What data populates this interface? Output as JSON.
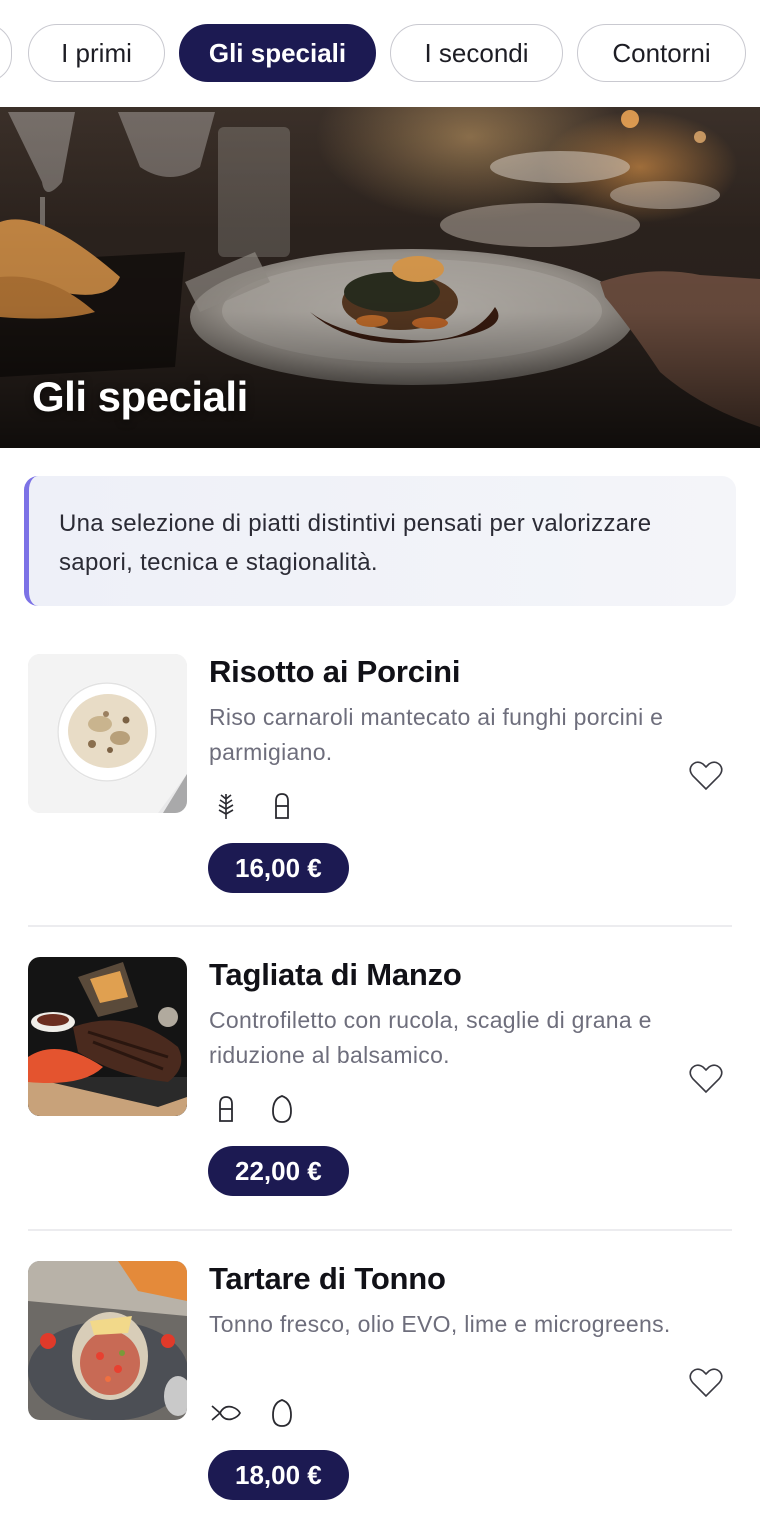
{
  "tabs": [
    {
      "label": "I primi"
    },
    {
      "label": "Gli speciali",
      "active": true
    },
    {
      "label": "I secondi"
    },
    {
      "label": "Contorni"
    }
  ],
  "hero": {
    "title": "Gli speciali"
  },
  "intro": {
    "text": "Una selezione di piatti distintivi pensati per valorizzare sapori, tecnica e stagionalità."
  },
  "dishes": [
    {
      "name": "Risotto ai Porcini",
      "description": "Riso carnaroli mantecato ai funghi porcini e parmigiano.",
      "tags": [
        "wheat-icon",
        "dairy-icon"
      ],
      "price": "16,00 €"
    },
    {
      "name": "Tagliata di Manzo",
      "description": "Controfiletto con rucola, scaglie di grana e riduzione al balsamico.",
      "tags": [
        "dairy-icon",
        "egg-icon"
      ],
      "price": "22,00 €"
    },
    {
      "name": "Tartare di Tonno",
      "description": "Tonno fresco, olio EVO, lime e microgreens.",
      "tags": [
        "fish-icon",
        "egg-icon"
      ],
      "price": "18,00 €"
    }
  ],
  "colors": {
    "accent": "#1c1a52",
    "intro_border": "#7c72e6",
    "intro_bg": "#eef0f8",
    "muted_text": "#6e6e7c"
  }
}
